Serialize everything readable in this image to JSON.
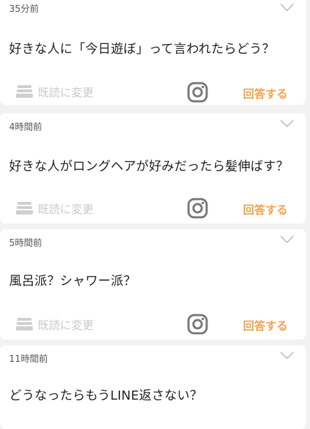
{
  "posts": [
    {
      "time": "35分前",
      "question": "好きな人に「今日遊ぼ」って言われたらどう？",
      "mark_read": "既読に変更",
      "answer": "回答する"
    },
    {
      "time": "4時間前",
      "question": "好きな人がロングヘアが好みだったら髪伸ばす？",
      "mark_read": "既読に変更",
      "answer": "回答する"
    },
    {
      "time": "5時間前",
      "question": "風呂派？シャワー派？",
      "mark_read": "既読に変更",
      "answer": "回答する"
    },
    {
      "time": "11時間前",
      "question": "どうなったらもうLINE返さない？"
    }
  ],
  "icons": {
    "collapse": "chevron-down-icon",
    "mark_read": "tray-stack-icon",
    "share": "instagram-icon"
  },
  "colors": {
    "accent": "#f5a24a",
    "muted": "#c9c9c9",
    "background": "#f2f2f2"
  }
}
